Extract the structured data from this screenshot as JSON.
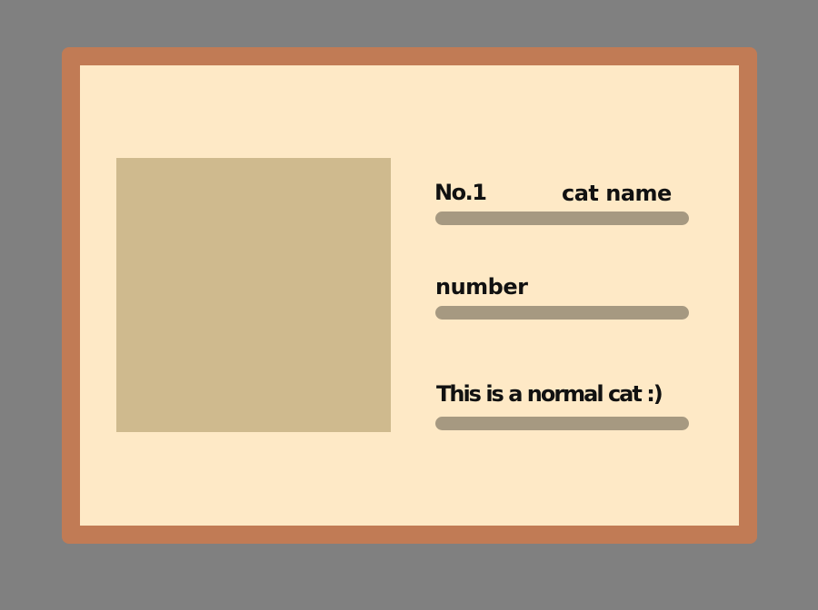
{
  "card": {
    "id_label": "No.1",
    "name_label": "cat name",
    "number_label": "number",
    "description": "This is a normal cat :)"
  },
  "colors": {
    "background": "#808080",
    "frame": "#c17b55",
    "card": "#fee9c6",
    "photo_placeholder": "#cfba8e",
    "field_bar": "#a69981",
    "text": "#111111"
  }
}
